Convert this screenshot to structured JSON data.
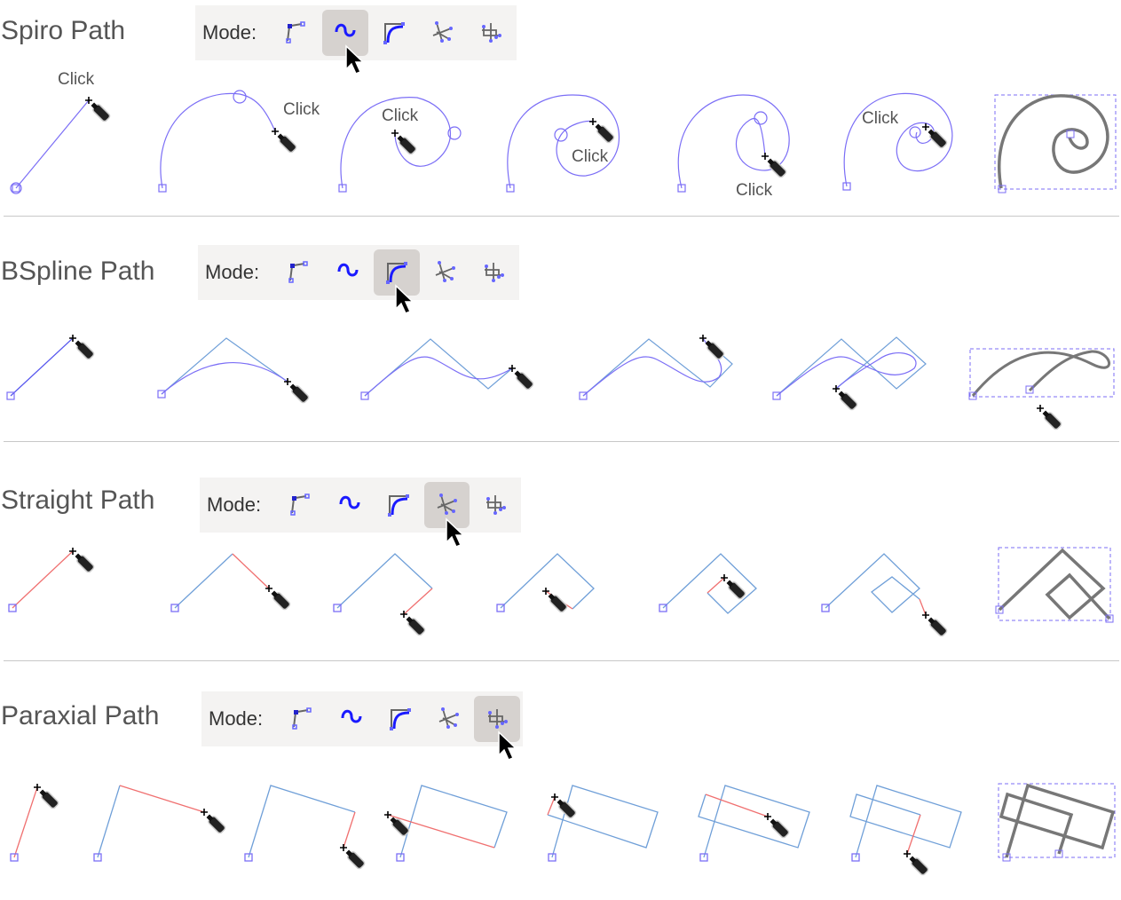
{
  "sections": [
    {
      "title": "Spiro Path",
      "mode_label": "Mode:",
      "active_mode": 1
    },
    {
      "title": "BSpline Path",
      "mode_label": "Mode:",
      "active_mode": 2
    },
    {
      "title": "Straight Path",
      "mode_label": "Mode:",
      "active_mode": 3
    },
    {
      "title": "Paraxial Path",
      "mode_label": "Mode:",
      "active_mode": 4
    }
  ],
  "modes": [
    "regular-bezier-icon",
    "spiro-icon",
    "bspline-icon",
    "straight-lines-icon",
    "paraxial-icon"
  ],
  "click_labels": [
    "Click",
    "Click",
    "Click",
    "Click",
    "Click",
    "Click"
  ],
  "colors": {
    "curve": "#7b6ef6",
    "control": "#6f9fd8",
    "segment_new": "#f07070",
    "result": "#777777",
    "icon": "#1a1aff"
  }
}
